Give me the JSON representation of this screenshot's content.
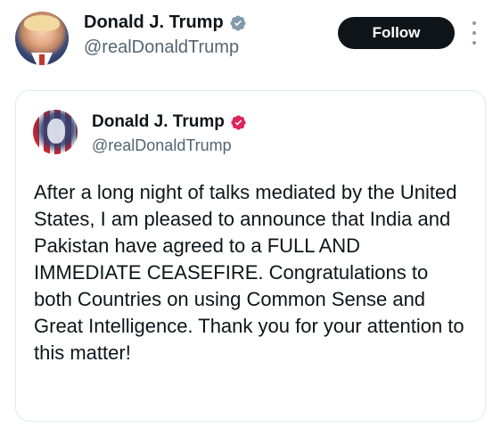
{
  "header": {
    "display_name": "Donald J. Trump",
    "handle": "@realDonaldTrump",
    "follow_label": "Follow"
  },
  "quoted": {
    "display_name": "Donald J. Trump",
    "handle": "@realDonaldTrump",
    "text": "After a long night of talks mediated by the United States, I am pleased to announce that India and Pakistan have agreed to a FULL AND IMMEDIATE CEASEFIRE. Congratulations to both Countries on using Common Sense and Great Intelligence. Thank you for your attention to this matter!"
  },
  "icons": {
    "header_verified": "verified-badge-gray",
    "quoted_verified": "verified-badge-pink",
    "more": "more-vertical-icon"
  },
  "colors": {
    "follow_bg": "#0f1419",
    "header_badge": "#829aab",
    "quoted_badge": "#e0245e",
    "handle": "#536471"
  }
}
